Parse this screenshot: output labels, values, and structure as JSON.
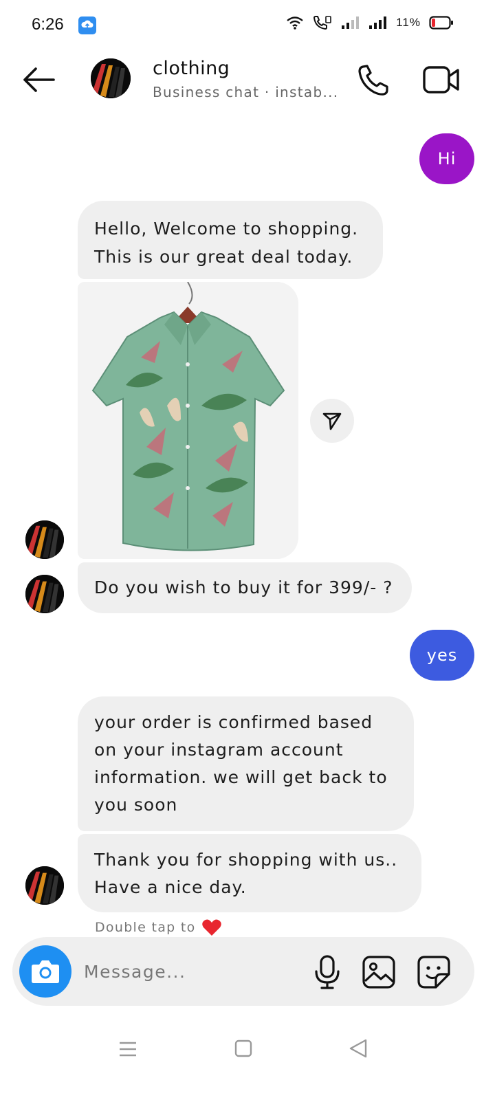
{
  "status_bar": {
    "time": "6:26",
    "battery_percent": "11%",
    "icons": [
      "cloud-upload-icon",
      "wifi-icon",
      "call-signal-icon",
      "signal-icon",
      "signal-icon",
      "battery-low-icon"
    ]
  },
  "header": {
    "title": "clothing",
    "subtitle": "Business chat · instab..."
  },
  "messages": [
    {
      "from": "me",
      "text": "Hi",
      "color": "#9a15c7"
    },
    {
      "from": "them",
      "text": "Hello, Welcome to shopping.\nThis is our great deal today."
    },
    {
      "from": "them",
      "type": "image",
      "description_icon": "shirt-image"
    },
    {
      "from": "them",
      "text": "Do you wish to buy it for 399/- ?"
    },
    {
      "from": "me",
      "text": "yes",
      "color": "#3d5be0"
    },
    {
      "from": "them",
      "text": "your order is confirmed based on your instagram account information. we will get back to you soon"
    },
    {
      "from": "them",
      "text": "Thank you for shopping with us..\nHave a nice day."
    }
  ],
  "double_tap_hint": "Double tap to",
  "composer": {
    "placeholder": "Message..."
  },
  "colors": {
    "accent_blue": "#1e8ff2",
    "bubble_gray": "#efefef",
    "heart_red": "#e8262f"
  }
}
